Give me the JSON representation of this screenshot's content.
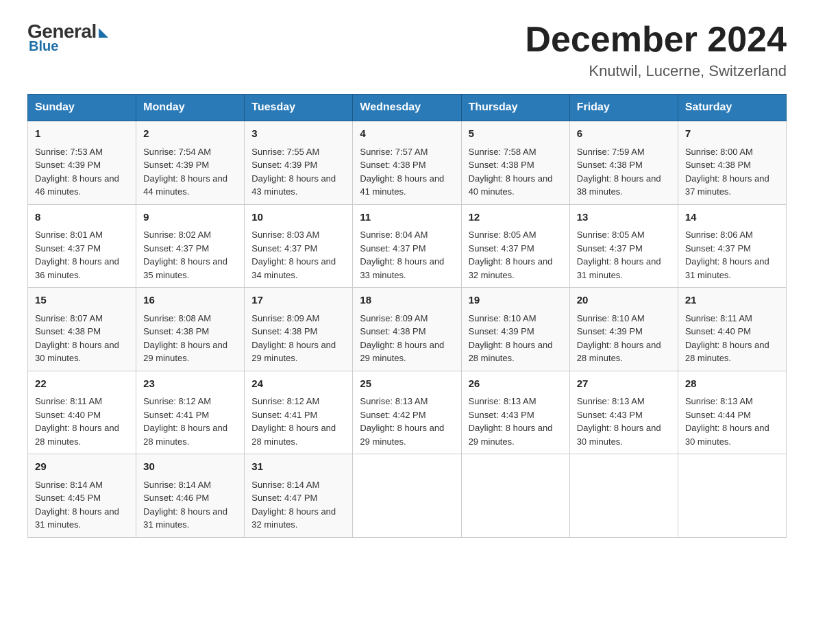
{
  "logo": {
    "general": "General",
    "blue": "Blue"
  },
  "title": "December 2024",
  "location": "Knutwil, Lucerne, Switzerland",
  "headers": [
    "Sunday",
    "Monday",
    "Tuesday",
    "Wednesday",
    "Thursday",
    "Friday",
    "Saturday"
  ],
  "weeks": [
    [
      {
        "day": "1",
        "sunrise": "Sunrise: 7:53 AM",
        "sunset": "Sunset: 4:39 PM",
        "daylight": "Daylight: 8 hours and 46 minutes."
      },
      {
        "day": "2",
        "sunrise": "Sunrise: 7:54 AM",
        "sunset": "Sunset: 4:39 PM",
        "daylight": "Daylight: 8 hours and 44 minutes."
      },
      {
        "day": "3",
        "sunrise": "Sunrise: 7:55 AM",
        "sunset": "Sunset: 4:39 PM",
        "daylight": "Daylight: 8 hours and 43 minutes."
      },
      {
        "day": "4",
        "sunrise": "Sunrise: 7:57 AM",
        "sunset": "Sunset: 4:38 PM",
        "daylight": "Daylight: 8 hours and 41 minutes."
      },
      {
        "day": "5",
        "sunrise": "Sunrise: 7:58 AM",
        "sunset": "Sunset: 4:38 PM",
        "daylight": "Daylight: 8 hours and 40 minutes."
      },
      {
        "day": "6",
        "sunrise": "Sunrise: 7:59 AM",
        "sunset": "Sunset: 4:38 PM",
        "daylight": "Daylight: 8 hours and 38 minutes."
      },
      {
        "day": "7",
        "sunrise": "Sunrise: 8:00 AM",
        "sunset": "Sunset: 4:38 PM",
        "daylight": "Daylight: 8 hours and 37 minutes."
      }
    ],
    [
      {
        "day": "8",
        "sunrise": "Sunrise: 8:01 AM",
        "sunset": "Sunset: 4:37 PM",
        "daylight": "Daylight: 8 hours and 36 minutes."
      },
      {
        "day": "9",
        "sunrise": "Sunrise: 8:02 AM",
        "sunset": "Sunset: 4:37 PM",
        "daylight": "Daylight: 8 hours and 35 minutes."
      },
      {
        "day": "10",
        "sunrise": "Sunrise: 8:03 AM",
        "sunset": "Sunset: 4:37 PM",
        "daylight": "Daylight: 8 hours and 34 minutes."
      },
      {
        "day": "11",
        "sunrise": "Sunrise: 8:04 AM",
        "sunset": "Sunset: 4:37 PM",
        "daylight": "Daylight: 8 hours and 33 minutes."
      },
      {
        "day": "12",
        "sunrise": "Sunrise: 8:05 AM",
        "sunset": "Sunset: 4:37 PM",
        "daylight": "Daylight: 8 hours and 32 minutes."
      },
      {
        "day": "13",
        "sunrise": "Sunrise: 8:05 AM",
        "sunset": "Sunset: 4:37 PM",
        "daylight": "Daylight: 8 hours and 31 minutes."
      },
      {
        "day": "14",
        "sunrise": "Sunrise: 8:06 AM",
        "sunset": "Sunset: 4:37 PM",
        "daylight": "Daylight: 8 hours and 31 minutes."
      }
    ],
    [
      {
        "day": "15",
        "sunrise": "Sunrise: 8:07 AM",
        "sunset": "Sunset: 4:38 PM",
        "daylight": "Daylight: 8 hours and 30 minutes."
      },
      {
        "day": "16",
        "sunrise": "Sunrise: 8:08 AM",
        "sunset": "Sunset: 4:38 PM",
        "daylight": "Daylight: 8 hours and 29 minutes."
      },
      {
        "day": "17",
        "sunrise": "Sunrise: 8:09 AM",
        "sunset": "Sunset: 4:38 PM",
        "daylight": "Daylight: 8 hours and 29 minutes."
      },
      {
        "day": "18",
        "sunrise": "Sunrise: 8:09 AM",
        "sunset": "Sunset: 4:38 PM",
        "daylight": "Daylight: 8 hours and 29 minutes."
      },
      {
        "day": "19",
        "sunrise": "Sunrise: 8:10 AM",
        "sunset": "Sunset: 4:39 PM",
        "daylight": "Daylight: 8 hours and 28 minutes."
      },
      {
        "day": "20",
        "sunrise": "Sunrise: 8:10 AM",
        "sunset": "Sunset: 4:39 PM",
        "daylight": "Daylight: 8 hours and 28 minutes."
      },
      {
        "day": "21",
        "sunrise": "Sunrise: 8:11 AM",
        "sunset": "Sunset: 4:40 PM",
        "daylight": "Daylight: 8 hours and 28 minutes."
      }
    ],
    [
      {
        "day": "22",
        "sunrise": "Sunrise: 8:11 AM",
        "sunset": "Sunset: 4:40 PM",
        "daylight": "Daylight: 8 hours and 28 minutes."
      },
      {
        "day": "23",
        "sunrise": "Sunrise: 8:12 AM",
        "sunset": "Sunset: 4:41 PM",
        "daylight": "Daylight: 8 hours and 28 minutes."
      },
      {
        "day": "24",
        "sunrise": "Sunrise: 8:12 AM",
        "sunset": "Sunset: 4:41 PM",
        "daylight": "Daylight: 8 hours and 28 minutes."
      },
      {
        "day": "25",
        "sunrise": "Sunrise: 8:13 AM",
        "sunset": "Sunset: 4:42 PM",
        "daylight": "Daylight: 8 hours and 29 minutes."
      },
      {
        "day": "26",
        "sunrise": "Sunrise: 8:13 AM",
        "sunset": "Sunset: 4:43 PM",
        "daylight": "Daylight: 8 hours and 29 minutes."
      },
      {
        "day": "27",
        "sunrise": "Sunrise: 8:13 AM",
        "sunset": "Sunset: 4:43 PM",
        "daylight": "Daylight: 8 hours and 30 minutes."
      },
      {
        "day": "28",
        "sunrise": "Sunrise: 8:13 AM",
        "sunset": "Sunset: 4:44 PM",
        "daylight": "Daylight: 8 hours and 30 minutes."
      }
    ],
    [
      {
        "day": "29",
        "sunrise": "Sunrise: 8:14 AM",
        "sunset": "Sunset: 4:45 PM",
        "daylight": "Daylight: 8 hours and 31 minutes."
      },
      {
        "day": "30",
        "sunrise": "Sunrise: 8:14 AM",
        "sunset": "Sunset: 4:46 PM",
        "daylight": "Daylight: 8 hours and 31 minutes."
      },
      {
        "day": "31",
        "sunrise": "Sunrise: 8:14 AM",
        "sunset": "Sunset: 4:47 PM",
        "daylight": "Daylight: 8 hours and 32 minutes."
      },
      null,
      null,
      null,
      null
    ]
  ]
}
